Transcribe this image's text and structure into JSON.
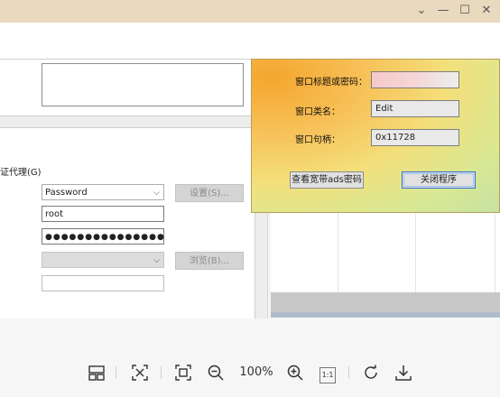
{
  "window": {
    "minimize_glyph": "⌄",
    "min_glyph": "—",
    "max_glyph": "☐",
    "close_glyph": "✕"
  },
  "settings": {
    "proxy_label": "证代理(G)",
    "auth_type_value": "Password",
    "settings_button": "设置(S)...",
    "username_value": "root",
    "password_dots": "●●●●●●●●●●●●●●●",
    "browse_button": "浏览(B)..."
  },
  "dialog": {
    "title_label": "窗口标题或密码：",
    "class_label": "窗口类名：",
    "class_value": "Edit",
    "handle_label": "窗口句柄：",
    "handle_value": "0x11728",
    "view_button": "查看宽带ads密码",
    "close_button": "关闭程序"
  },
  "toolbar": {
    "zoom_level": "100%",
    "one_to_one": "1:1"
  },
  "icons": {
    "thumbnails": "thumbnails-icon",
    "fit": "fit-window-icon",
    "fullscreen": "fullscreen-icon",
    "zoom_out": "zoom-out-icon",
    "zoom_in": "zoom-in-icon",
    "actual_size": "actual-size-icon",
    "rotate": "rotate-icon",
    "download": "download-icon"
  }
}
